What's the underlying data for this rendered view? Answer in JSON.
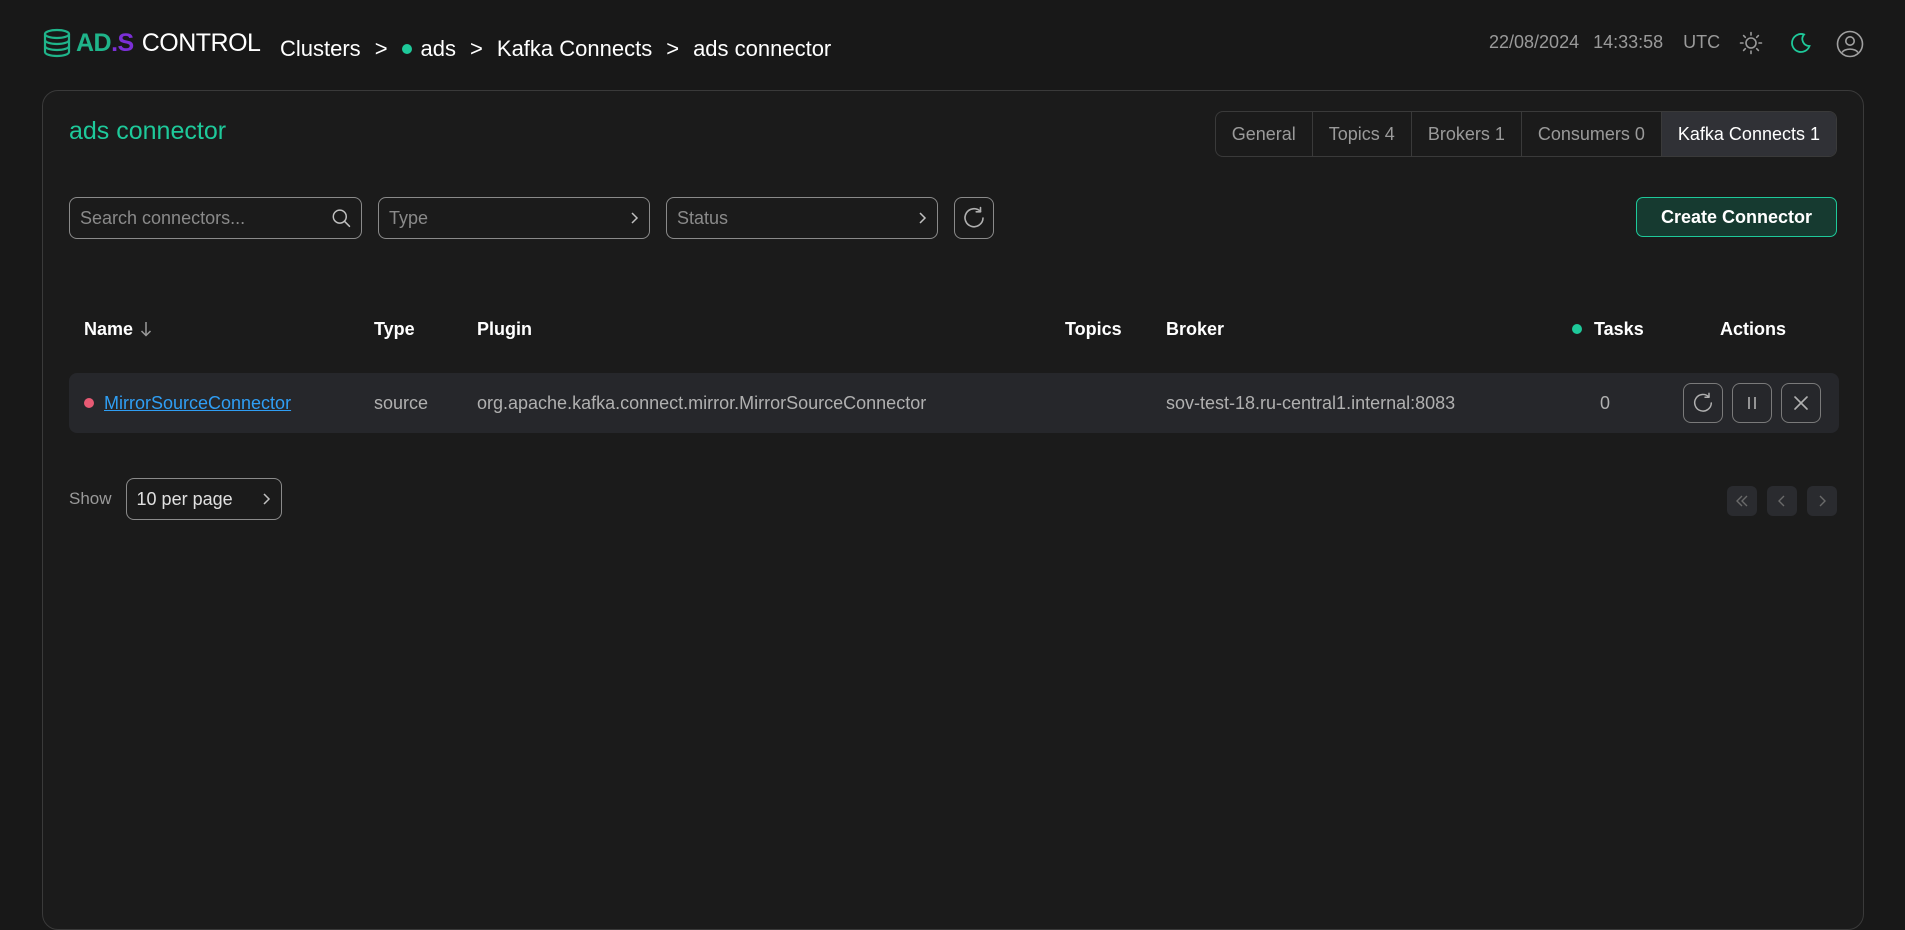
{
  "brand": {
    "part1": "AD",
    "part2": ".S",
    "part3": "CONTROL"
  },
  "breadcrumb": {
    "clusters": "Clusters",
    "cluster": "ads",
    "section": "Kafka Connects",
    "current": "ads connector",
    "separator": ">"
  },
  "header": {
    "date": "22/08/2024",
    "time": "14:33:58",
    "timezone": "UTC"
  },
  "page": {
    "title": "ads connector"
  },
  "tabs": [
    {
      "label": "General"
    },
    {
      "label": "Topics 4"
    },
    {
      "label": "Brokers 1"
    },
    {
      "label": "Consumers 0"
    },
    {
      "label": "Kafka Connects 1",
      "active": true
    }
  ],
  "filters": {
    "search_placeholder": "Search connectors...",
    "type_placeholder": "Type",
    "status_placeholder": "Status"
  },
  "create_button": "Create Connector",
  "table": {
    "columns": {
      "name": "Name",
      "type": "Type",
      "plugin": "Plugin",
      "topics": "Topics",
      "broker": "Broker",
      "tasks": "Tasks",
      "actions": "Actions"
    },
    "rows": [
      {
        "name": "MirrorSourceConnector",
        "status_color": "#e85a74",
        "type": "source",
        "plugin": "org.apache.kafka.connect.mirror.MirrorSourceConnector",
        "topics": "",
        "broker": "sov-test-18.ru-central1.internal:8083",
        "tasks": "0"
      }
    ]
  },
  "pagination": {
    "show_label": "Show",
    "per_page": "10 per page"
  },
  "colors": {
    "accent": "#1ec99a",
    "error": "#e85a74",
    "link": "#2f9ef4",
    "background": "#181818"
  }
}
